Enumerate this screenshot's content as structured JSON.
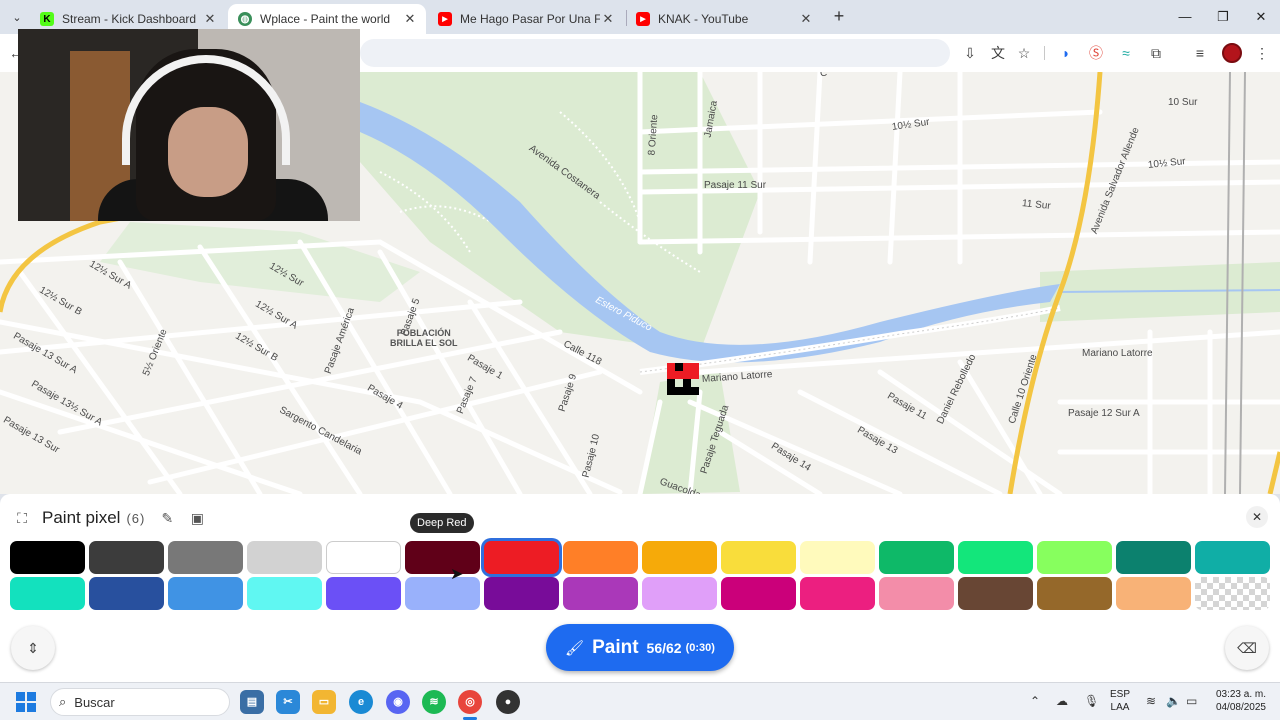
{
  "browser": {
    "tabs": [
      {
        "title": "Stream - Kick Dashboard",
        "favicon": "kick-icon",
        "active": false
      },
      {
        "title": "Wplace - Paint the world",
        "favicon": "globe-icon",
        "active": true
      },
      {
        "title": "Me Hago Pasar Por Una Figura",
        "favicon": "youtube-icon",
        "active": false
      },
      {
        "title": "KNAK - YouTube",
        "favicon": "youtube-icon",
        "active": false
      }
    ],
    "new_tab": "+",
    "window_controls": {
      "minimize": "—",
      "maximize": "❐",
      "close": "✕"
    }
  },
  "map": {
    "labels": [
      {
        "text": "10 Sur"
      },
      {
        "text": "10½ Sur"
      },
      {
        "text": "10½ Sur"
      },
      {
        "text": "11 Sur"
      },
      {
        "text": "Pasaje 11 Sur"
      },
      {
        "text": "Avenida Costanera"
      },
      {
        "text": "8 Oriente"
      },
      {
        "text": "Jamaica"
      },
      {
        "text": "Avenida Salvador Allende"
      },
      {
        "text": "12½ Sur A"
      },
      {
        "text": "12½ Sur B"
      },
      {
        "text": "12½ Sur"
      },
      {
        "text": "12½ Sur A"
      },
      {
        "text": "12½ Sur B"
      },
      {
        "text": "Pasaje 13 Sur A"
      },
      {
        "text": "Pasaje 13½ Sur A"
      },
      {
        "text": "Pasaje 13 Sur"
      },
      {
        "text": "5½ Oriente"
      },
      {
        "text": "Pasaje América"
      },
      {
        "text": "Pasaje 5"
      },
      {
        "text": "Pasaje 4"
      },
      {
        "text": "Sargento Candelaria"
      },
      {
        "text": "Pasaje 7"
      },
      {
        "text": "Pasaje 1"
      },
      {
        "text": "Calle 118"
      },
      {
        "text": "Pasaje 9"
      },
      {
        "text": "Pasaje 10"
      },
      {
        "text": "Mariano Latorre"
      },
      {
        "text": "Mariano Latorre"
      },
      {
        "text": "Pasaje Teguada"
      },
      {
        "text": "Guacolda"
      },
      {
        "text": "Pasaje 14"
      },
      {
        "text": "Pasaje 13"
      },
      {
        "text": "Pasaje 11"
      },
      {
        "text": "Daniel Rebolledo"
      },
      {
        "text": "Calle 10 Oriente"
      },
      {
        "text": "Pasaje 12 Sur A"
      },
      {
        "text": "Estero Piduco"
      },
      {
        "text": "C"
      }
    ],
    "neighborhood": "POBLACIÓN\nBRILLA EL SOL",
    "colors": {
      "land": "#f3f2ee",
      "road": "#ffffff",
      "park": "#dcebd2",
      "river": "#a6c6f2",
      "highway": "#f3c542"
    }
  },
  "panel": {
    "title": "Paint pixel",
    "count": "(6)",
    "tooltip": "Deep Red",
    "palette": [
      {
        "name": "Black",
        "color": "#000000"
      },
      {
        "name": "Dark Gray",
        "color": "#3c3c3c"
      },
      {
        "name": "Gray",
        "color": "#787878"
      },
      {
        "name": "Light Gray",
        "color": "#d2d2d2"
      },
      {
        "name": "White",
        "color": "#ffffff"
      },
      {
        "name": "Deep Red",
        "color": "#600018"
      },
      {
        "name": "Red",
        "color": "#ed1c24",
        "selected": true
      },
      {
        "name": "Orange",
        "color": "#ff7f27"
      },
      {
        "name": "Gold",
        "color": "#f6aa09"
      },
      {
        "name": "Yellow",
        "color": "#f9dd3b"
      },
      {
        "name": "Light Yellow",
        "color": "#fffabc"
      },
      {
        "name": "Dark Green",
        "color": "#0eb968"
      },
      {
        "name": "Green",
        "color": "#13e67b"
      },
      {
        "name": "Light Green",
        "color": "#87ff5e"
      },
      {
        "name": "Dark Teal",
        "color": "#0c816e"
      },
      {
        "name": "Teal",
        "color": "#10aea6"
      },
      {
        "name": "Light Teal",
        "color": "#13e1be"
      },
      {
        "name": "Dark Blue",
        "color": "#28509e"
      },
      {
        "name": "Blue",
        "color": "#4093e4"
      },
      {
        "name": "Cyan",
        "color": "#60f7f2"
      },
      {
        "name": "Indigo",
        "color": "#6b50f6"
      },
      {
        "name": "Light Indigo",
        "color": "#99b1fb"
      },
      {
        "name": "Dark Purple",
        "color": "#780c99"
      },
      {
        "name": "Purple",
        "color": "#aa38b9"
      },
      {
        "name": "Light Purple",
        "color": "#e09ff9"
      },
      {
        "name": "Dark Pink",
        "color": "#cb007a"
      },
      {
        "name": "Pink",
        "color": "#ec1f80"
      },
      {
        "name": "Light Pink",
        "color": "#f38da9"
      },
      {
        "name": "Dark Brown",
        "color": "#684634"
      },
      {
        "name": "Brown",
        "color": "#95682a"
      },
      {
        "name": "Beige",
        "color": "#f8b277"
      },
      {
        "name": "Transparent",
        "color": "transparent"
      }
    ],
    "paint_button": {
      "label": "Paint",
      "count": "56/62",
      "timer": "(0:30)"
    },
    "accent": "#1e6bf0"
  },
  "taskbar": {
    "search_placeholder": "Buscar",
    "language": "ESP",
    "keyboard": "LAA",
    "time": "03:23 a. m.",
    "date": "04/08/2025"
  }
}
